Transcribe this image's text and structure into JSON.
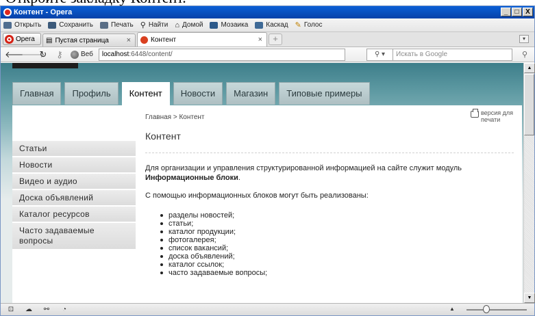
{
  "caption": "Откройте закладку Контент.",
  "window": {
    "title": "Контент - Opera",
    "buttons": {
      "minimize": "_",
      "maximize": "□",
      "close": "X"
    }
  },
  "toolbar": {
    "items": [
      {
        "label": "Открыть"
      },
      {
        "label": "Сохранить"
      },
      {
        "label": "Печать"
      },
      {
        "label": "Найти"
      },
      {
        "label": "Домой"
      },
      {
        "label": "Мозаика"
      },
      {
        "label": "Каскад"
      },
      {
        "label": "Голос"
      }
    ]
  },
  "tabs": {
    "opera_button": "Opera",
    "items": [
      {
        "label": "Пустая страница",
        "close": "×"
      },
      {
        "label": "Контент",
        "close": "×"
      }
    ],
    "new_tab": "+"
  },
  "address": {
    "web_label": "Веб",
    "url_host": "localhost",
    "url_path": ":6448/content/",
    "search_placeholder": "Искать в Google"
  },
  "site": {
    "nav": [
      "Главная",
      "Профиль",
      "Контент",
      "Новости",
      "Магазин",
      "Типовые примеры"
    ],
    "breadcrumb": "Главная > Контент",
    "print_link": "версия для печати",
    "heading": "Контент",
    "sidebar": [
      "Статьи",
      "Новости",
      "Видео и аудио",
      "Доска объявлений",
      "Каталог ресурсов",
      "Часто задаваемые вопросы"
    ],
    "para1_text": "Для организации и управления структурированной информацией на сайте служит модуль",
    "para1_bold": "Информационные блоки",
    "para1_end": ".",
    "para2": "С помощью информационных блоков могут быть реализованы:",
    "list": [
      "разделы новостей;",
      "статьи;",
      "каталог продукции;",
      "фотогалерея;",
      "список вакансий;",
      "доска объявлений;",
      "каталог ссылок;",
      "часто задаваемые вопросы;"
    ]
  },
  "colors": {
    "titlebar": "#0741a8",
    "site_bg": "#5d99a2",
    "active_tab": "#ffffff"
  }
}
